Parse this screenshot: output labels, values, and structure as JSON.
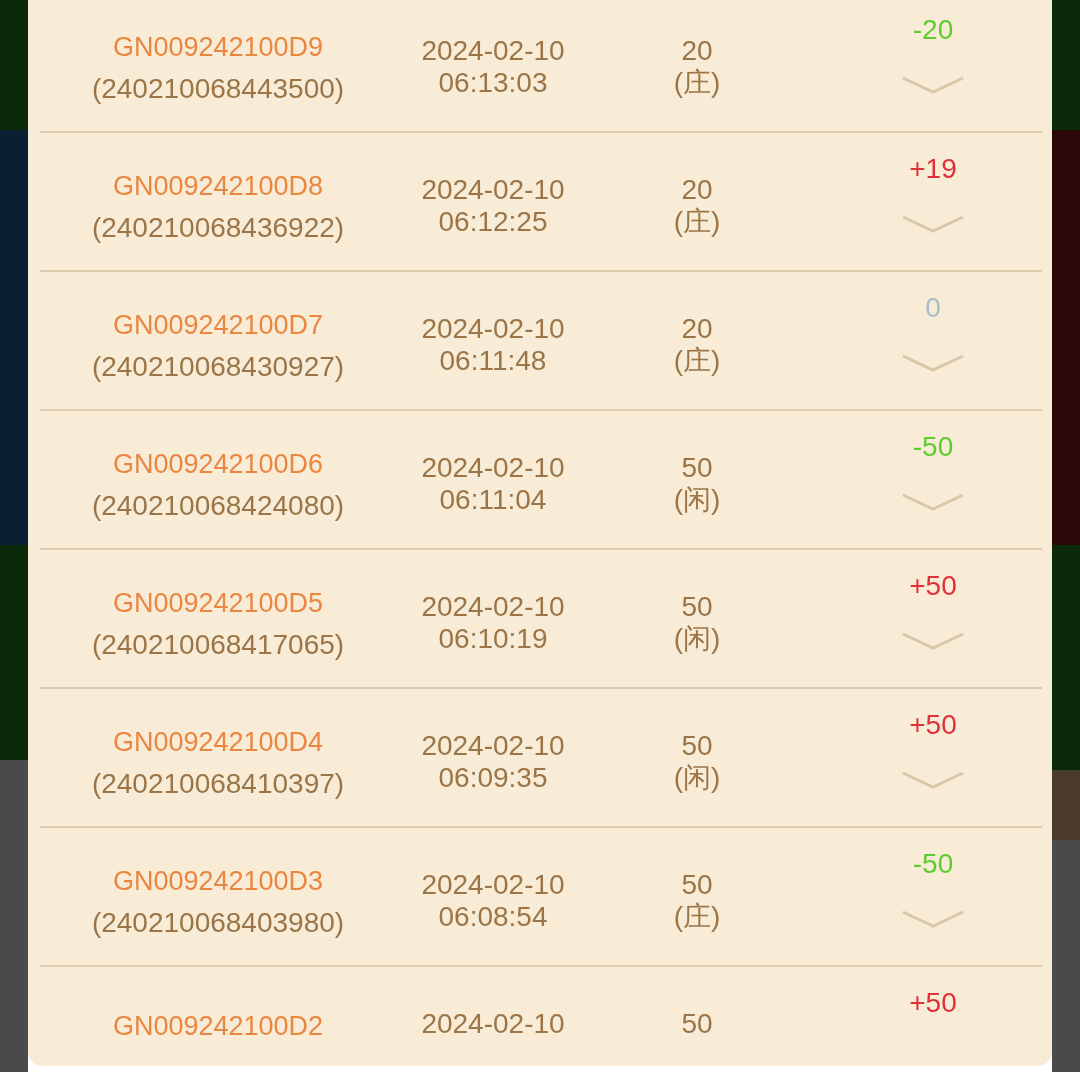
{
  "records": [
    {
      "game_id": "GN009242100D9",
      "order_no": "(240210068443500)",
      "date": "2024-02-10",
      "time": "06:13:03",
      "amount": "20",
      "side": "(庄)",
      "result": "-20",
      "kind": "loss"
    },
    {
      "game_id": "GN009242100D8",
      "order_no": "(240210068436922)",
      "date": "2024-02-10",
      "time": "06:12:25",
      "amount": "20",
      "side": "(庄)",
      "result": "+19",
      "kind": "win"
    },
    {
      "game_id": "GN009242100D7",
      "order_no": "(240210068430927)",
      "date": "2024-02-10",
      "time": "06:11:48",
      "amount": "20",
      "side": "(庄)",
      "result": "0",
      "kind": "even"
    },
    {
      "game_id": "GN009242100D6",
      "order_no": "(240210068424080)",
      "date": "2024-02-10",
      "time": "06:11:04",
      "amount": "50",
      "side": "(闲)",
      "result": "-50",
      "kind": "loss"
    },
    {
      "game_id": "GN009242100D5",
      "order_no": "(240210068417065)",
      "date": "2024-02-10",
      "time": "06:10:19",
      "amount": "50",
      "side": "(闲)",
      "result": "+50",
      "kind": "win"
    },
    {
      "game_id": "GN009242100D4",
      "order_no": "(240210068410397)",
      "date": "2024-02-10",
      "time": "06:09:35",
      "amount": "50",
      "side": "(闲)",
      "result": "+50",
      "kind": "win"
    },
    {
      "game_id": "GN009242100D3",
      "order_no": "(240210068403980)",
      "date": "2024-02-10",
      "time": "06:08:54",
      "amount": "50",
      "side": "(庄)",
      "result": "-50",
      "kind": "loss"
    },
    {
      "game_id": "GN009242100D2",
      "date": "2024-02-10",
      "amount": "50",
      "result": "+50",
      "kind": "win"
    }
  ]
}
